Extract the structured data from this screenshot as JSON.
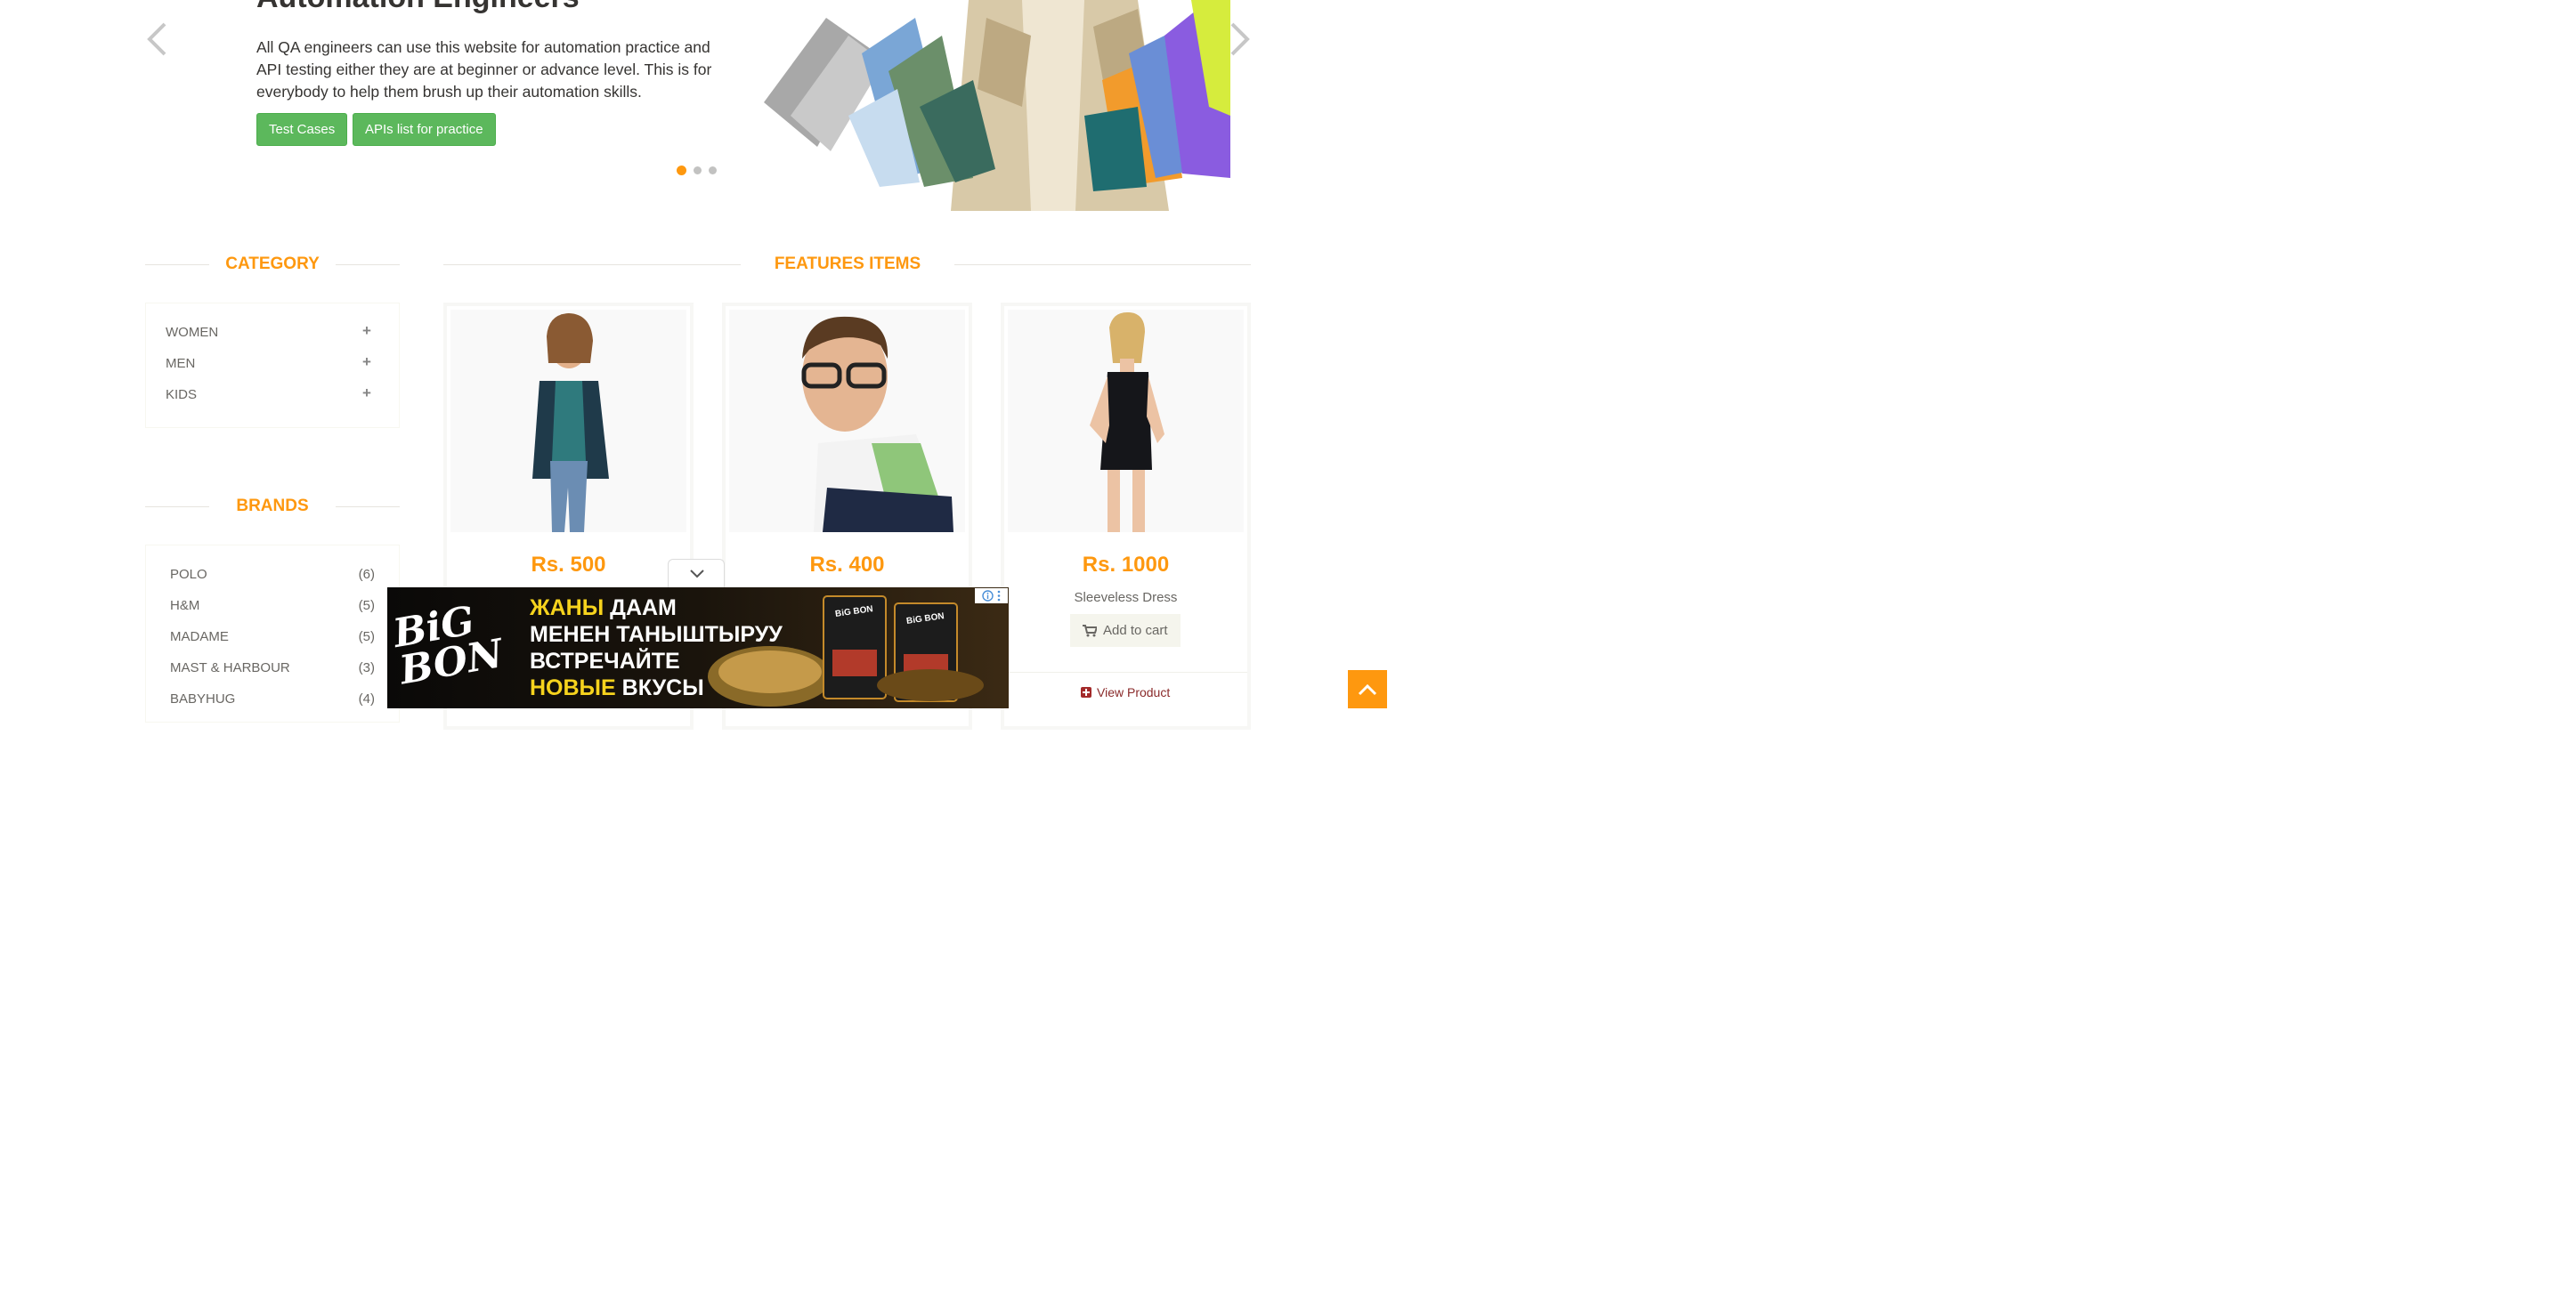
{
  "carousel": {
    "title": "Automation Engineers",
    "description": "All QA engineers can use this website for automation practice and API testing either they are at beginner or advance level. This is for everybody to help them brush up their automation skills.",
    "buttons": {
      "test_cases": "Test Cases",
      "apis_list": "APIs list for practice"
    },
    "active_slide": 1,
    "slide_count": 3
  },
  "category": {
    "title": "CATEGORY",
    "items": [
      {
        "label": "WOMEN"
      },
      {
        "label": "MEN"
      },
      {
        "label": "KIDS"
      }
    ]
  },
  "brands": {
    "title": "BRANDS",
    "items": [
      {
        "name": "POLO",
        "count": "(6)"
      },
      {
        "name": "H&M",
        "count": "(5)"
      },
      {
        "name": "MADAME",
        "count": "(5)"
      },
      {
        "name": "MAST & HARBOUR",
        "count": "(3)"
      },
      {
        "name": "BABYHUG",
        "count": "(4)"
      }
    ]
  },
  "features": {
    "title": "FEATURES ITEMS",
    "products": [
      {
        "price": "Rs. 500"
      },
      {
        "price": "Rs. 400"
      },
      {
        "price": "Rs. 1000",
        "name": "Sleeveless Dress",
        "add_to_cart": "Add to cart",
        "view_product": "View Product"
      }
    ]
  },
  "ad": {
    "brand": "BiG BON",
    "line1a": "ЖАНЫ",
    "line1b": "ДААМ",
    "line2": "МЕНЕН ТАНЫШТЫРУУ",
    "line3": "ВСТРЕЧАЙТЕ",
    "line4a": "НОВЫЕ",
    "line4b": "ВКУСЫ",
    "pack_label": "BiG BON"
  },
  "colors": {
    "accent": "#fe980f",
    "button_green": "#5cb85c"
  }
}
